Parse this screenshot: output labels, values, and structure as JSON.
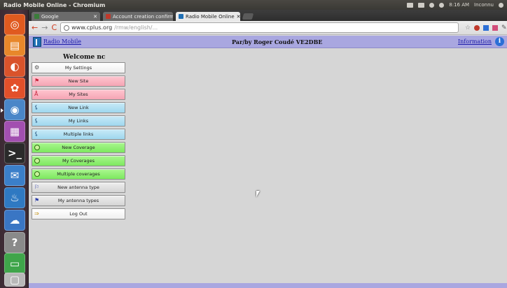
{
  "window": {
    "title": "Radio Mobile Online - Chromium"
  },
  "tray": {
    "clock": "8:16 AM",
    "user": "Inconnu"
  },
  "tabs": [
    {
      "label": "Google",
      "color": "#3a7d3a"
    },
    {
      "label": "Account creation confirm...",
      "color": "#c0392b"
    },
    {
      "label": "Radio Mobile Online",
      "color": "#1f6fb4"
    }
  ],
  "address": {
    "domain": "www.cplus.org",
    "path": "/rmw/english/..."
  },
  "header": {
    "site_link": "Radio Mobile",
    "center_text": "Par/by Roger Coudé VE2DBE",
    "info_link": "Information",
    "info_icon": "i"
  },
  "welcome": "Welcome nc",
  "menu": [
    {
      "label": "My Settings",
      "icon": "gear-icon",
      "glyph": "⚙",
      "style": "white"
    },
    {
      "label": "New Site",
      "icon": "site-icon",
      "glyph": "⚑",
      "style": "pink"
    },
    {
      "label": "My Sites",
      "icon": "site-icon",
      "glyph": "Å",
      "style": "pink"
    },
    {
      "label": "New Link",
      "icon": "link-icon",
      "glyph": "⚸",
      "style": "blue"
    },
    {
      "label": "My Links",
      "icon": "link-icon",
      "glyph": "⚸",
      "style": "blue"
    },
    {
      "label": "Multiple links",
      "icon": "link-icon",
      "glyph": "⚸",
      "style": "blue"
    },
    {
      "label": "New Coverage",
      "icon": "coverage-icon",
      "glyph": "",
      "style": "green"
    },
    {
      "label": "My Coverages",
      "icon": "coverage-icon",
      "glyph": "",
      "style": "green"
    },
    {
      "label": "Multiple coverages",
      "icon": "coverage-icon",
      "glyph": "",
      "style": "green"
    },
    {
      "label": "New antenna type",
      "icon": "antenna-icon",
      "glyph": "⚐",
      "style": "grey"
    },
    {
      "label": "My antenna types",
      "icon": "antenna-icon",
      "glyph": "⚑",
      "style": "grey"
    },
    {
      "label": "Log Out",
      "icon": "logout-icon",
      "glyph": "⇒",
      "style": "white"
    }
  ],
  "launcher": [
    {
      "name": "ubuntu-logo-icon",
      "color": "#e05a1f",
      "glyph": "◎"
    },
    {
      "name": "files-icon",
      "color": "#e8872a",
      "glyph": "▤"
    },
    {
      "name": "firefox-icon",
      "color": "#d9532b",
      "glyph": "◐"
    },
    {
      "name": "settings-icon",
      "color": "#e3502a",
      "glyph": "✿"
    },
    {
      "name": "chromium-icon",
      "color": "#4a86c8",
      "glyph": "◉"
    },
    {
      "name": "workspace-icon",
      "color": "#a24fb0",
      "glyph": "▦"
    },
    {
      "name": "terminal-icon",
      "color": "#2a2a2a",
      "glyph": ">_"
    },
    {
      "name": "messaging-icon",
      "color": "#3b7fc9",
      "glyph": "✉"
    },
    {
      "name": "app-icon",
      "color": "#2f79c2",
      "glyph": "♨"
    },
    {
      "name": "cloud-icon",
      "color": "#3a76c4",
      "glyph": "☁"
    },
    {
      "name": "help-icon",
      "color": "#8a8a8a",
      "glyph": "?"
    },
    {
      "name": "archive-icon",
      "color": "#3fa54a",
      "glyph": "▭"
    },
    {
      "name": "trash-icon",
      "color": "#b8b8b8",
      "glyph": "▢"
    }
  ]
}
